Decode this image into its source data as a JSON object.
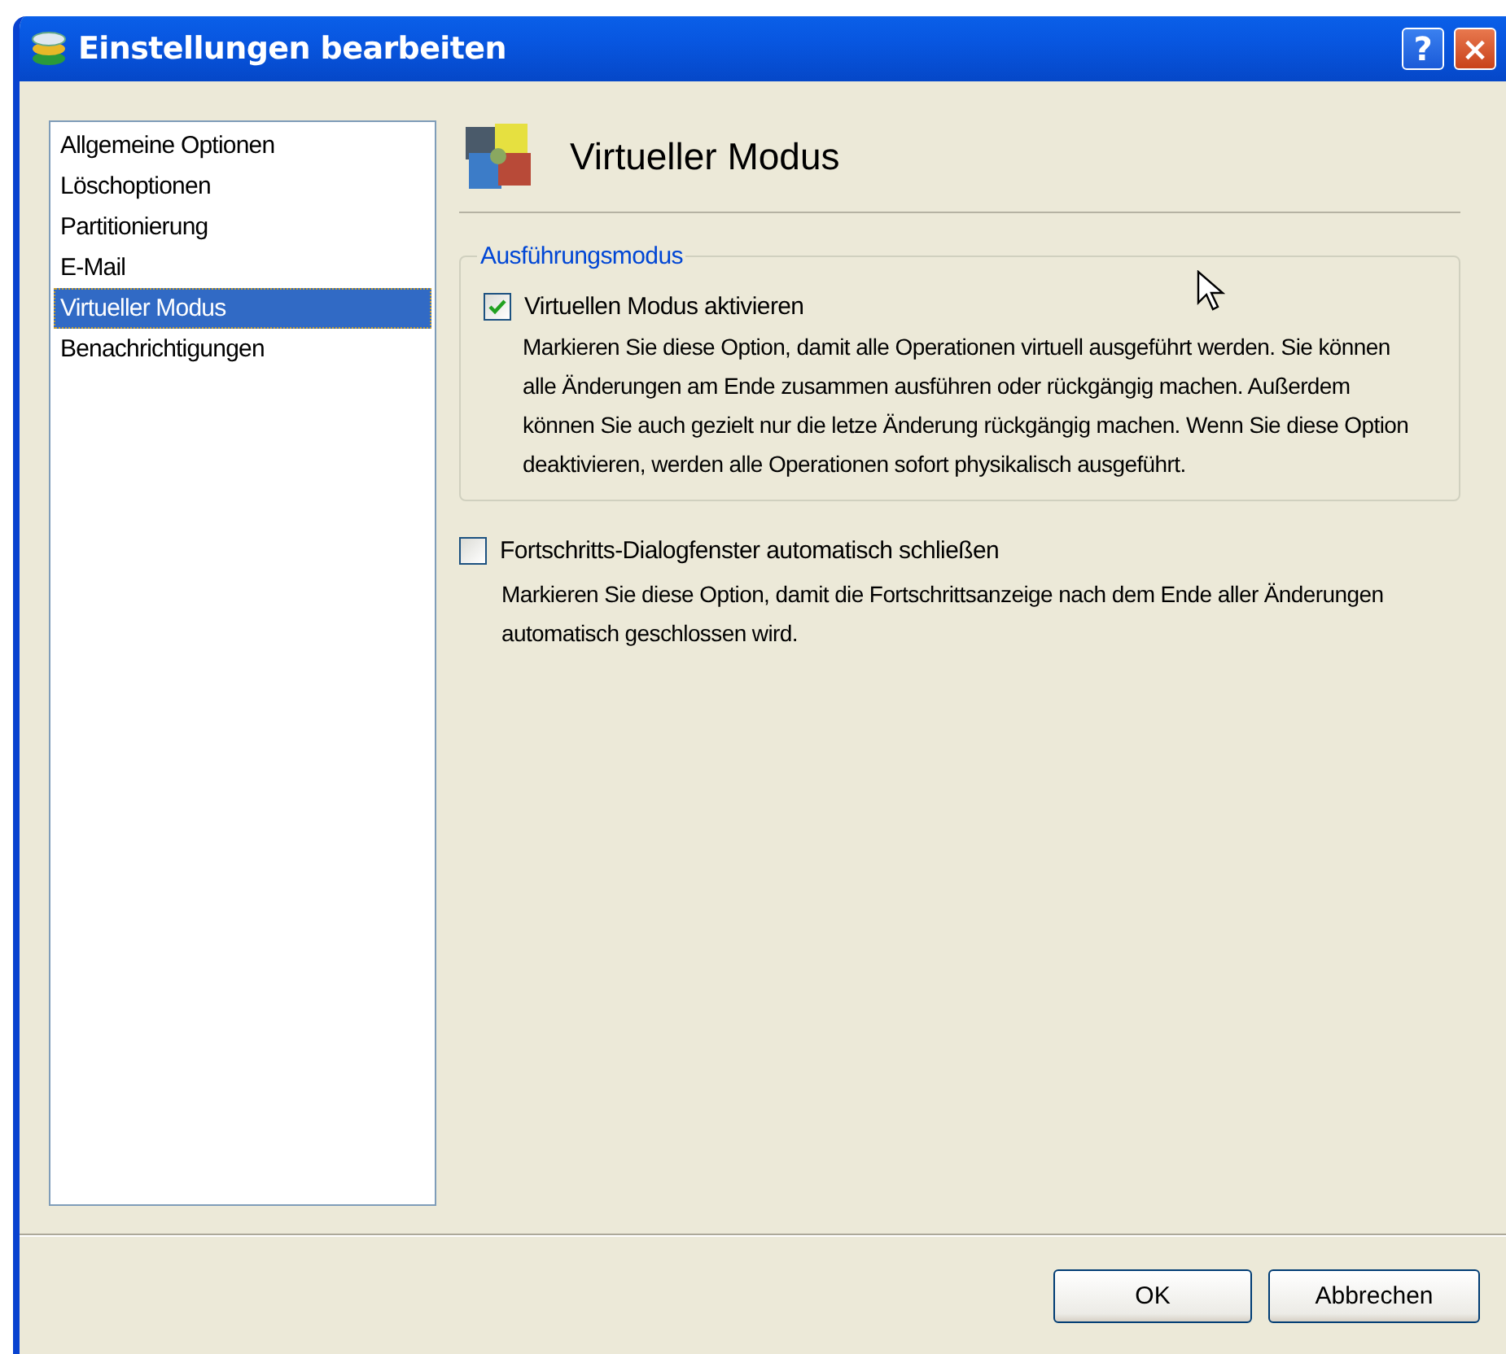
{
  "window": {
    "title": "Einstellungen bearbeiten",
    "help_label": "?",
    "close_label": "×"
  },
  "sidebar": {
    "items": [
      {
        "label": "Allgemeine Optionen",
        "selected": false
      },
      {
        "label": "Löschoptionen",
        "selected": false
      },
      {
        "label": "Partitionierung",
        "selected": false
      },
      {
        "label": "E-Mail",
        "selected": false
      },
      {
        "label": "Virtueller Modus",
        "selected": true
      },
      {
        "label": "Benachrichtigungen",
        "selected": false
      }
    ]
  },
  "page": {
    "title": "Virtueller Modus",
    "group": {
      "title": "Ausführungsmodus",
      "option": {
        "label": "Virtuellen Modus aktivieren",
        "checked": true,
        "description": "Markieren Sie diese Option, damit alle Operationen virtuell ausgeführt werden. Sie können alle Änderungen am Ende zusammen ausführen oder rückgängig machen. Außerdem können Sie auch gezielt nur die letze Änderung rückgängig machen. Wenn Sie diese Option deaktivieren, werden alle Operationen sofort physikalisch ausgeführt."
      }
    },
    "option": {
      "label": "Fortschritts-Dialogfenster automatisch schließen",
      "checked": false,
      "description": "Markieren Sie diese Option, damit die Fortschrittsanzeige nach dem Ende aller Änderungen automatisch geschlossen wird."
    }
  },
  "buttons": [
    "OK",
    "Abbrechen"
  ]
}
